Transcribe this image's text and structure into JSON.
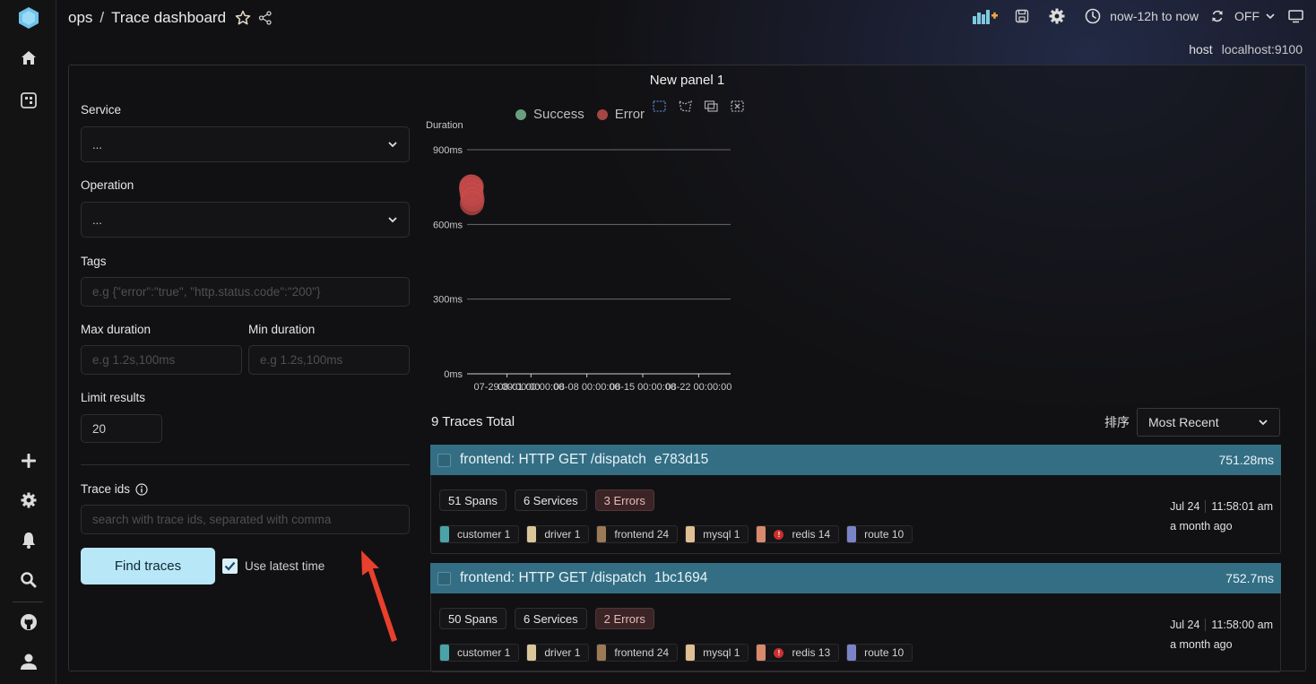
{
  "app": {
    "breadcrumb": [
      "ops",
      "Trace dashboard"
    ],
    "breadcrumb_separator": "/"
  },
  "sidebar": {
    "top_items": [
      {
        "name": "logo",
        "icon": "hexagon-logo-icon"
      },
      {
        "name": "home",
        "icon": "home-icon"
      },
      {
        "name": "dashboards",
        "icon": "dashboard-grid-icon"
      }
    ],
    "bottom_items": [
      {
        "name": "add",
        "icon": "plus-icon"
      },
      {
        "name": "settings",
        "icon": "gear-icon"
      },
      {
        "name": "alerts",
        "icon": "bell-icon"
      },
      {
        "name": "explore",
        "icon": "search-icon"
      },
      {
        "name": "github",
        "icon": "github-icon"
      },
      {
        "name": "user",
        "icon": "user-icon"
      }
    ]
  },
  "toolbar": {
    "add_panel_icon": "add-panel-icon",
    "save_icon": "save-icon",
    "settings_icon": "gear-icon",
    "time_range": "now-12h to now",
    "refresh_label": "OFF",
    "view_mode_icon": "monitor-icon"
  },
  "variables": {
    "host_label": "host",
    "host_value": "localhost:9100"
  },
  "panel": {
    "title": "New panel 1"
  },
  "form": {
    "service_label": "Service",
    "service_value": "...",
    "operation_label": "Operation",
    "operation_value": "...",
    "tags_label": "Tags",
    "tags_placeholder": "e.g {\"error\":\"true\", \"http.status.code\":\"200\"}",
    "max_duration_label": "Max duration",
    "max_duration_placeholder": "e.g 1.2s,100ms",
    "min_duration_label": "Min duration",
    "min_duration_placeholder": "e.g 1.2s,100ms",
    "limit_label": "Limit results",
    "limit_value": "20",
    "trace_ids_label": "Trace ids",
    "trace_ids_placeholder": "search with trace ids, separated with comma",
    "find_button": "Find traces",
    "use_latest_time_label": "Use latest time",
    "use_latest_time_checked": true
  },
  "chart_data": {
    "type": "scatter",
    "title": "",
    "ylabel": "Duration",
    "xlabel": "",
    "ylim": [
      0,
      900
    ],
    "yticks": [
      "0ms",
      "300ms",
      "600ms",
      "900ms"
    ],
    "ytick_values": [
      0,
      300,
      600,
      900
    ],
    "xticks": [
      "07-29 00:00:00",
      "08-01 00:00:00",
      "08-08 00:00:00",
      "08-15 00:00:00",
      "08-22 00:00:00"
    ],
    "xtick_days": [
      0,
      3,
      10,
      17,
      24
    ],
    "xlim_days": [
      -5,
      28
    ],
    "grid": true,
    "legend": [
      {
        "name": "Success",
        "color": "#6a9e7f"
      },
      {
        "name": "Error",
        "color": "#a64545"
      }
    ],
    "legend_position": "top-center",
    "series": [
      {
        "name": "Success",
        "points": []
      },
      {
        "name": "Error",
        "points": [
          {
            "x": -4.5,
            "y": 752.7
          },
          {
            "x": -4.4,
            "y": 751.28
          },
          {
            "x": -4.5,
            "y": 740
          },
          {
            "x": -4.4,
            "y": 720
          },
          {
            "x": -4.3,
            "y": 700
          },
          {
            "x": -4.4,
            "y": 685
          }
        ]
      }
    ]
  },
  "traces": {
    "total_label": "9 Traces Total",
    "sort_label": "排序",
    "sort_value": "Most Recent",
    "items": [
      {
        "title": "frontend: HTTP GET /dispatch",
        "id": "e783d15",
        "duration": "751.28ms",
        "spans": "51 Spans",
        "services": "6 Services",
        "errors": "3 Errors",
        "date": "Jul 24",
        "time": "11:58:01 am",
        "ago": "a month ago",
        "service_tags": [
          {
            "name": "customer 1",
            "color": "#4aa3a8",
            "error": false
          },
          {
            "name": "driver 1",
            "color": "#d9c79a",
            "error": false
          },
          {
            "name": "frontend 24",
            "color": "#9c7a56",
            "error": false
          },
          {
            "name": "mysql 1",
            "color": "#e0bf92",
            "error": false
          },
          {
            "name": "redis 14",
            "color": "#d98a6c",
            "error": true
          },
          {
            "name": "route 10",
            "color": "#7b83c7",
            "error": false
          }
        ]
      },
      {
        "title": "frontend: HTTP GET /dispatch",
        "id": "1bc1694",
        "duration": "752.7ms",
        "spans": "50 Spans",
        "services": "6 Services",
        "errors": "2 Errors",
        "date": "Jul 24",
        "time": "11:58:00 am",
        "ago": "a month ago",
        "service_tags": [
          {
            "name": "customer 1",
            "color": "#4aa3a8",
            "error": false
          },
          {
            "name": "driver 1",
            "color": "#d9c79a",
            "error": false
          },
          {
            "name": "frontend 24",
            "color": "#9c7a56",
            "error": false
          },
          {
            "name": "mysql 1",
            "color": "#e0bf92",
            "error": false
          },
          {
            "name": "redis 13",
            "color": "#d98a6c",
            "error": true
          },
          {
            "name": "route 10",
            "color": "#7b83c7",
            "error": false
          }
        ]
      }
    ]
  },
  "colors": {
    "accent": "#b8e8f7",
    "trace_header": "#336e84",
    "error_point": "#c24848",
    "annotation_arrow": "#e8402c"
  }
}
